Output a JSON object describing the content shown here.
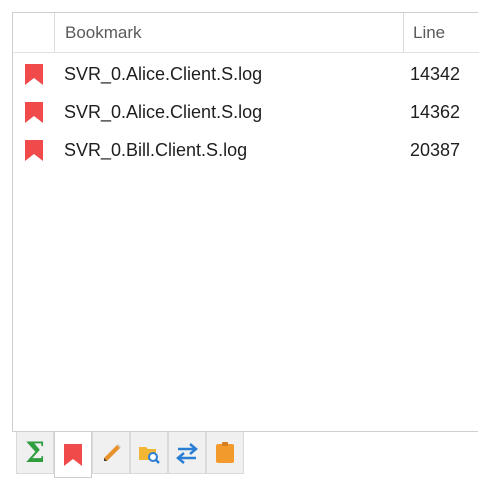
{
  "columns": {
    "bookmark": "Bookmark",
    "line": "Line"
  },
  "rows": [
    {
      "file": "SVR_0.Alice.Client.S.log",
      "line": "14342"
    },
    {
      "file": "SVR_0.Alice.Client.S.log",
      "line": "14362"
    },
    {
      "file": "SVR_0.Bill.Client.S.log",
      "line": "20387"
    }
  ],
  "colors": {
    "bookmark_flag": "#f04a4a",
    "sigma": "#2f9e3f",
    "pencil": "#e8912c",
    "folder": "#f2b632",
    "arrows": "#2a7fd4",
    "note": "#f39a2c"
  },
  "tabs": [
    {
      "icon": "sigma-icon",
      "active": false
    },
    {
      "icon": "bookmark-icon",
      "active": true
    },
    {
      "icon": "pencil-icon",
      "active": false
    },
    {
      "icon": "folder-search-icon",
      "active": false
    },
    {
      "icon": "swap-arrows-icon",
      "active": false
    },
    {
      "icon": "note-icon",
      "active": false
    }
  ]
}
